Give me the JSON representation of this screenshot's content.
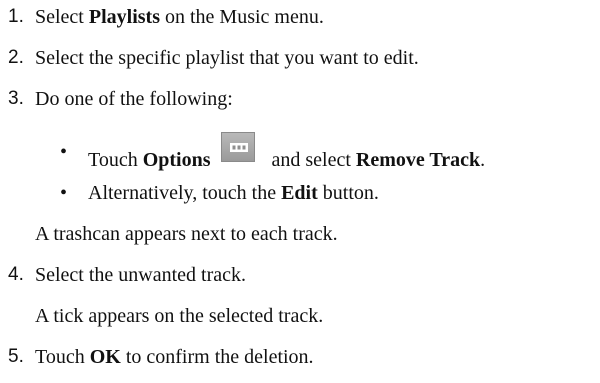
{
  "steps": [
    {
      "num": "1.",
      "pre": "Select ",
      "bold": "Playlists",
      "post": " on the Music menu."
    },
    {
      "num": "2.",
      "text": "Select the specific playlist that you want to edit."
    },
    {
      "num": "3.",
      "text": "Do one of the following:"
    },
    {
      "num": "4.",
      "text": "Select the unwanted track."
    },
    {
      "num": "5.",
      "pre": "Touch ",
      "bold": "OK",
      "post": " to confirm the deletion."
    }
  ],
  "bullets": [
    {
      "glyph": "•",
      "pre": "Touch ",
      "bold": "Options",
      "mid": " and select ",
      "bold2": "Remove Track",
      "post": "."
    },
    {
      "glyph": "•",
      "pre": "Alternatively, touch the ",
      "bold": "Edit",
      "post": " button."
    }
  ],
  "notes": {
    "step3": "A trashcan appears next to each track.",
    "step4": "A tick appears on the selected track."
  },
  "icons": {
    "options": "options-icon"
  }
}
